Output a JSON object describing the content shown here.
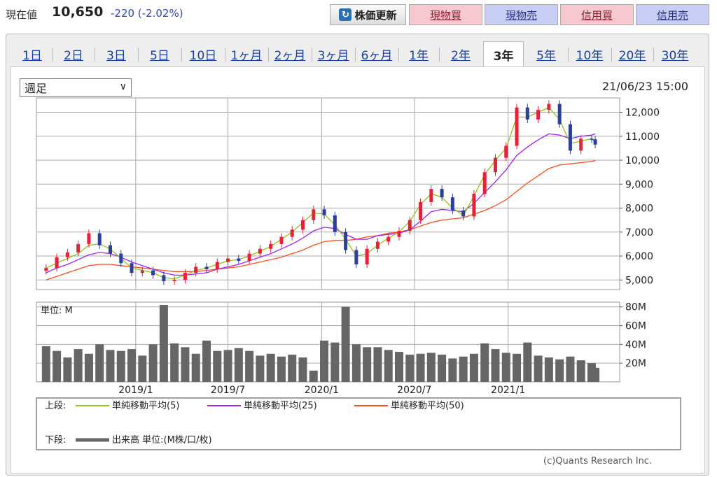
{
  "header": {
    "price_label": "現在値",
    "price_value": "10,650",
    "price_change": "-220 (-2.02%)",
    "buttons": {
      "update": "株価更新",
      "spot_buy": "現物買",
      "spot_sell": "現物売",
      "margin_buy": "信用買",
      "margin_sell": "信用売"
    }
  },
  "tabs": [
    "1日",
    "2日",
    "3日",
    "5日",
    "10日",
    "1ヶ月",
    "2ヶ月",
    "3ヶ月",
    "6ヶ月",
    "1年",
    "2年",
    "3年",
    "5年",
    "10年",
    "20年",
    "30年"
  ],
  "active_tab": "3年",
  "period_select": "週足",
  "datetime": "21/06/23 15:00",
  "copyright": "(c)Quants Research Inc.",
  "colors": {
    "up": "#e8203a",
    "down": "#2a3f9e",
    "ma5": "#8fc31f",
    "ma25": "#a020f0",
    "ma50": "#f05020",
    "volume": "#666666",
    "tab_link": "#1a3fa0"
  },
  "chart_data": [
    {
      "type": "candlestick",
      "x_tick_labels": [
        "2019/1",
        "2019/7",
        "2020/1",
        "2020/7",
        "2021/1"
      ],
      "y_tick_labels": [
        "12,000",
        "11,000",
        "10,000",
        "9,000",
        "8,000",
        "7,000",
        "6,000",
        "5,000"
      ],
      "ylim": [
        4600,
        12600
      ],
      "x_dates": [
        "2018-07-09",
        "2018-07-30",
        "2018-08-20",
        "2018-09-10",
        "2018-10-01",
        "2018-10-22",
        "2018-11-12",
        "2018-12-03",
        "2018-12-24",
        "2019-01-14",
        "2019-02-04",
        "2019-02-25",
        "2019-03-18",
        "2019-04-08",
        "2019-04-29",
        "2019-05-20",
        "2019-06-10",
        "2019-07-01",
        "2019-07-22",
        "2019-08-12",
        "2019-09-02",
        "2019-09-23",
        "2019-10-14",
        "2019-11-04",
        "2019-11-25",
        "2019-12-16",
        "2020-01-06",
        "2020-01-27",
        "2020-02-17",
        "2020-03-09",
        "2020-03-30",
        "2020-04-20",
        "2020-05-11",
        "2020-06-01",
        "2020-06-22",
        "2020-07-13",
        "2020-08-03",
        "2020-08-24",
        "2020-09-14",
        "2020-10-05",
        "2020-10-26",
        "2020-11-16",
        "2020-12-07",
        "2020-12-28",
        "2021-01-18",
        "2021-02-08",
        "2021-03-01",
        "2021-03-22",
        "2021-04-12",
        "2021-05-03",
        "2021-05-24",
        "2021-06-14",
        "2021-06-21"
      ],
      "close": [
        5500,
        5950,
        6150,
        6500,
        6950,
        6450,
        6100,
        5700,
        5300,
        5400,
        5200,
        4950,
        5000,
        5300,
        5550,
        5450,
        5750,
        5900,
        5800,
        6100,
        6300,
        6500,
        6800,
        7100,
        7500,
        7950,
        7700,
        7000,
        6250,
        5650,
        6300,
        6600,
        6800,
        7050,
        7500,
        8250,
        8800,
        8450,
        7900,
        7650,
        8600,
        9500,
        10100,
        10600,
        12200,
        11700,
        12100,
        12350,
        11500,
        10400,
        10900,
        10870,
        10650
      ],
      "ma5": [
        5500,
        5700,
        5900,
        6100,
        6450,
        6500,
        6300,
        5900,
        5500,
        5400,
        5300,
        5100,
        5050,
        5200,
        5400,
        5500,
        5650,
        5800,
        5850,
        6000,
        6200,
        6400,
        6700,
        7000,
        7400,
        7800,
        7750,
        7300,
        6700,
        6000,
        6100,
        6450,
        6750,
        7000,
        7450,
        8150,
        8600,
        8450,
        8000,
        7700,
        8500,
        9400,
        10000,
        10500,
        11800,
        11800,
        12000,
        12200,
        11700,
        10700,
        10800,
        10900,
        10750
      ],
      "ma25": [
        5300,
        5500,
        5650,
        5850,
        6050,
        6150,
        6100,
        5950,
        5750,
        5600,
        5450,
        5300,
        5200,
        5200,
        5250,
        5300,
        5450,
        5550,
        5650,
        5800,
        5950,
        6100,
        6300,
        6500,
        6750,
        7050,
        7200,
        7150,
        6900,
        6700,
        6700,
        6850,
        6900,
        6950,
        7100,
        7450,
        7850,
        7950,
        7900,
        7850,
        8200,
        8650,
        9100,
        9600,
        10200,
        10550,
        10850,
        11100,
        11050,
        10900,
        11000,
        11050,
        11100
      ],
      "ma50": [
        5000,
        5150,
        5300,
        5450,
        5600,
        5650,
        5650,
        5600,
        5550,
        5500,
        5450,
        5400,
        5350,
        5350,
        5350,
        5400,
        5450,
        5500,
        5550,
        5650,
        5750,
        5850,
        5950,
        6100,
        6250,
        6450,
        6600,
        6650,
        6650,
        6700,
        6800,
        6850,
        6950,
        7000,
        7100,
        7250,
        7400,
        7500,
        7550,
        7600,
        7750,
        7900,
        8100,
        8350,
        8700,
        9050,
        9350,
        9650,
        9800,
        9850,
        9900,
        9950,
        9980
      ]
    },
    {
      "type": "bar",
      "unit_label": "単位: M",
      "y_tick_labels": [
        "80M",
        "60M",
        "40M",
        "20M"
      ],
      "ylim": [
        0,
        85
      ],
      "values": [
        38,
        33,
        26,
        35,
        30,
        40,
        34,
        33,
        35,
        28,
        40,
        82,
        41,
        37,
        30,
        44,
        33,
        34,
        36,
        33,
        28,
        30,
        27,
        29,
        26,
        12,
        44,
        42,
        80,
        40,
        37,
        37,
        34,
        32,
        29,
        30,
        31,
        29,
        25,
        27,
        30,
        41,
        35,
        31,
        30,
        42,
        28,
        26,
        24,
        27,
        23,
        20,
        15
      ]
    }
  ],
  "legend": {
    "upper_label": "上段:",
    "lower_label": "下段:",
    "items": [
      "単純移動平均(5)",
      "単純移動平均(25)",
      "単純移動平均(50)"
    ],
    "volume_label": "出来高 単位:(M株/口/枚)"
  }
}
